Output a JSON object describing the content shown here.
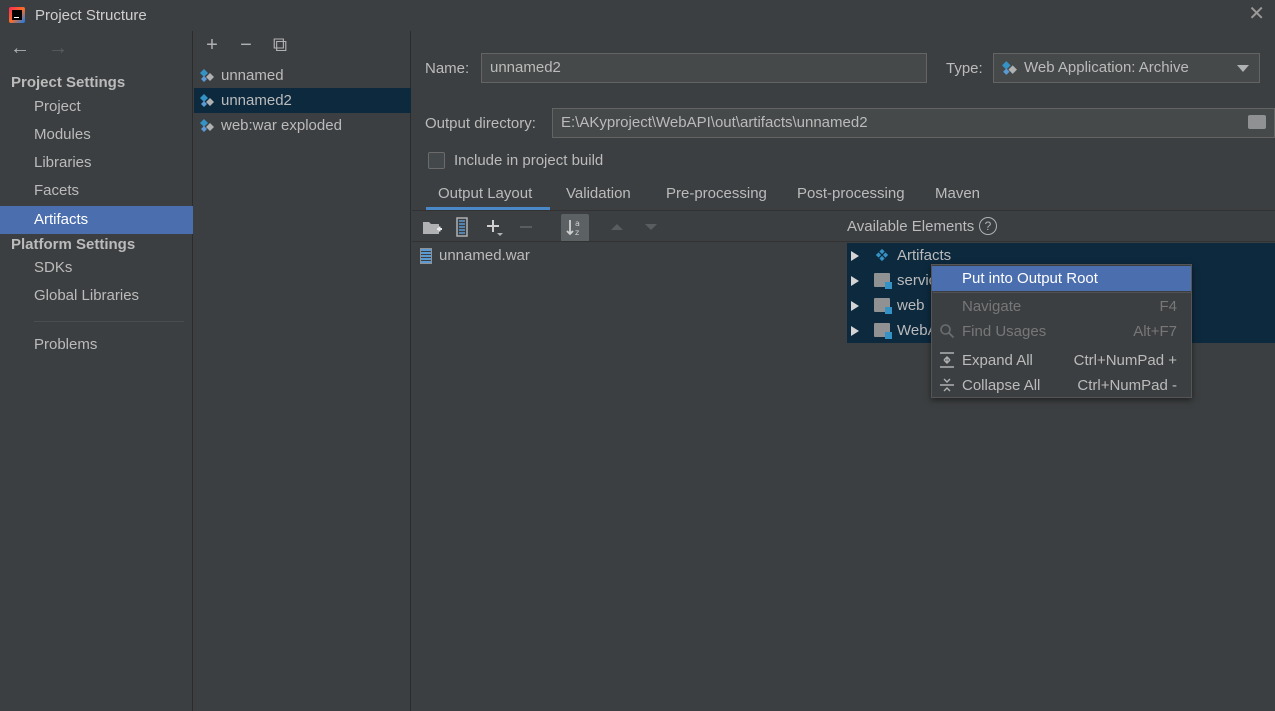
{
  "window": {
    "title": "Project Structure",
    "close_glyph": "✕"
  },
  "nav": {
    "back": "←",
    "forward": "→"
  },
  "sidebar": {
    "project_settings_title": "Project Settings",
    "project_items": [
      "Project",
      "Modules",
      "Libraries",
      "Facets",
      "Artifacts"
    ],
    "platform_settings_title": "Platform Settings",
    "platform_items": [
      "SDKs",
      "Global Libraries"
    ],
    "problems": "Problems",
    "selected": "Artifacts"
  },
  "artifacts_toolbar": {
    "add": "+",
    "remove": "−",
    "copy": "⧉"
  },
  "artifacts": [
    "unnamed",
    "unnamed2",
    "web:war exploded"
  ],
  "artifacts_selected": "unnamed2",
  "form": {
    "name_label": "Name:",
    "name_value": "unnamed2",
    "type_label": "Type:",
    "type_value": "Web Application: Archive",
    "output_dir_label": "Output directory:",
    "output_dir_value": "E:\\AKyproject\\WebAPI\\out\\artifacts\\unnamed2",
    "include_label": "Include in project build",
    "include_checked": false
  },
  "tabs": [
    "Output Layout",
    "Validation",
    "Pre-processing",
    "Post-processing",
    "Maven"
  ],
  "active_tab": "Output Layout",
  "available_elements_label": "Available Elements",
  "help_glyph": "?",
  "output_layout_items": [
    "unnamed.war"
  ],
  "available_items": [
    "Artifacts",
    "servic",
    "web",
    "WebA"
  ],
  "context_menu": {
    "items": [
      {
        "label": "Put into Output Root",
        "shortcut": "",
        "state": "highlight"
      },
      {
        "label": "Navigate",
        "shortcut": "F4",
        "state": "disabled"
      },
      {
        "label": "Find Usages",
        "shortcut": "Alt+F7",
        "state": "disabled"
      },
      {
        "label": "Expand All",
        "shortcut": "Ctrl+NumPad +",
        "state": "normal"
      },
      {
        "label": "Collapse All",
        "shortcut": "Ctrl+NumPad -",
        "state": "normal"
      }
    ]
  },
  "colors": {
    "background": "#3c3f41",
    "selection_blue": "#4b6eaf",
    "tree_selection": "#0d293e",
    "tab_underline": "#4a88c7"
  }
}
